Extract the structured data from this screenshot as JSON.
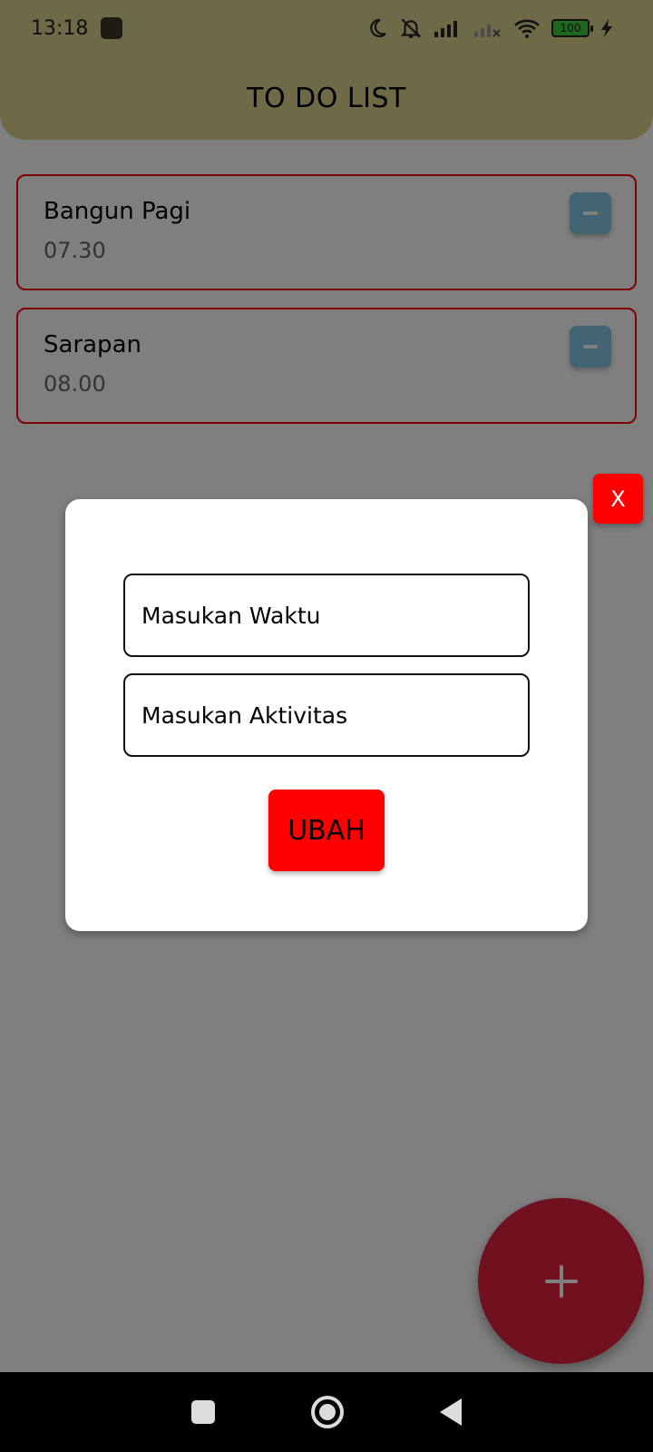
{
  "status_bar": {
    "time": "13:18",
    "battery_level": "100",
    "icons": [
      "moon-icon",
      "bell-off-icon",
      "signal-icon",
      "signal-no-service-icon",
      "wifi-icon",
      "battery-icon",
      "charging-bolt-icon"
    ]
  },
  "header": {
    "title": "TO DO LIST"
  },
  "tasks": [
    {
      "name": "Bangun Pagi",
      "time": "07.30"
    },
    {
      "name": "Sarapan",
      "time": "08.00"
    }
  ],
  "modal": {
    "close_label": "X",
    "time_placeholder": "Masukan Waktu",
    "activity_placeholder": "Masukan Aktivitas",
    "submit_label": "UBAH"
  },
  "colors": {
    "header_bg": "#ddd28f",
    "card_border": "#ff0000",
    "remove_button": "#85c8e6",
    "fab": "#e2233f",
    "submit_button": "#ff0000"
  }
}
